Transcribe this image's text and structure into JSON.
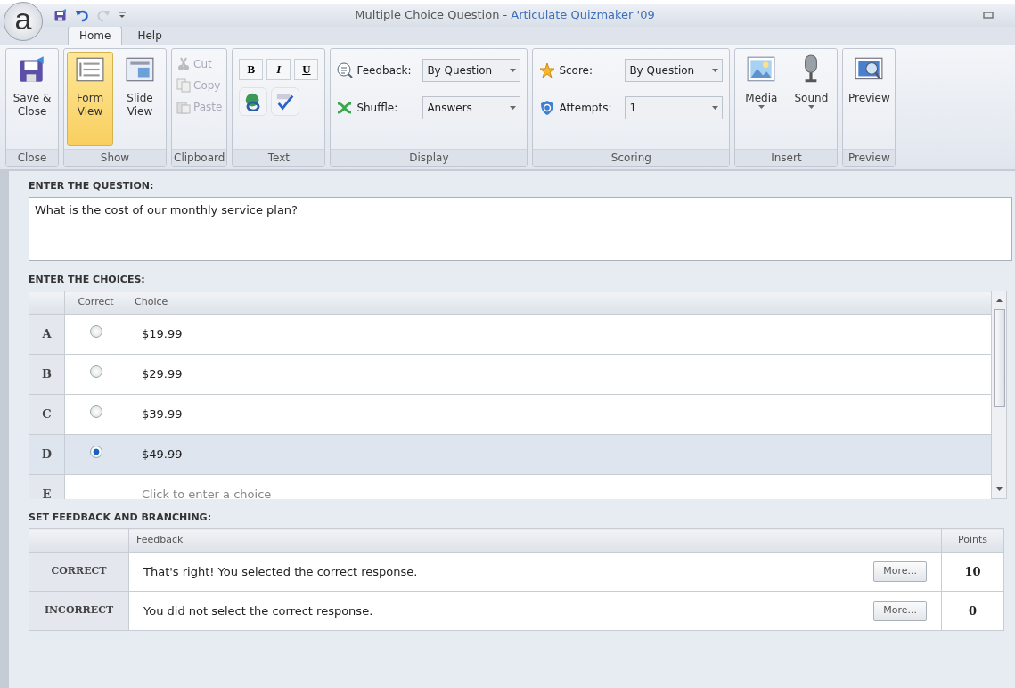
{
  "window": {
    "title": "Multiple Choice Question - ",
    "app_name": "Articulate Quizmaker '09"
  },
  "app_button": {
    "label": "a"
  },
  "quick_access": [
    {
      "disabled": false
    },
    {
      "disabled": false
    },
    {
      "disabled": true
    },
    {
      "disabled": false
    }
  ],
  "tabs": [
    {
      "label": "Home",
      "selected": true
    },
    {
      "label": "Help",
      "selected": false
    }
  ],
  "ribbon_groups": [
    {
      "label": "Close",
      "kind": "large",
      "items": [
        {
          "label": "Save & Close",
          "selected": false,
          "dropdown": false
        }
      ]
    },
    {
      "label": "Show",
      "kind": "large",
      "items": [
        {
          "label": "Form View",
          "selected": true,
          "dropdown": false
        },
        {
          "label": "Slide View",
          "selected": false,
          "dropdown": false
        }
      ]
    },
    {
      "label": "Clipboard",
      "kind": "small",
      "items": [
        {
          "label": "Cut",
          "disabled": true
        },
        {
          "label": "Copy",
          "disabled": true
        },
        {
          "label": "Paste",
          "disabled": true
        }
      ]
    },
    {
      "label": "Text",
      "kind": "text",
      "format": [
        "B",
        "I",
        "U"
      ]
    },
    {
      "label": "Display",
      "kind": "fields",
      "items": [
        {
          "label": "Feedback:",
          "value": "By Question"
        },
        {
          "label": "Shuffle:",
          "value": "Answers"
        }
      ]
    },
    {
      "label": "Scoring",
      "kind": "fields",
      "items": [
        {
          "label": "Score:",
          "value": "By Question"
        },
        {
          "label": "Attempts:",
          "value": "1"
        }
      ]
    },
    {
      "label": "Insert",
      "kind": "large",
      "items": [
        {
          "label": "Media",
          "selected": false,
          "dropdown": true
        },
        {
          "label": "Sound",
          "selected": false,
          "dropdown": true
        }
      ]
    },
    {
      "label": "Preview",
      "kind": "large",
      "items": [
        {
          "label": "Preview",
          "selected": false,
          "dropdown": false
        }
      ]
    }
  ],
  "question": {
    "heading": "ENTER THE QUESTION:",
    "value": "What is the cost of our monthly service plan?"
  },
  "choices": {
    "heading": "ENTER THE CHOICES:",
    "columns": [
      "Correct",
      "Choice"
    ],
    "rows": [
      {
        "letter": "A",
        "text": "$19.99",
        "correct": false,
        "selected": false
      },
      {
        "letter": "B",
        "text": "$29.99",
        "correct": false,
        "selected": false
      },
      {
        "letter": "C",
        "text": "$39.99",
        "correct": false,
        "selected": false
      },
      {
        "letter": "D",
        "text": "$49.99",
        "correct": true,
        "selected": true
      },
      {
        "letter": "E",
        "placeholder": "Click to enter a choice",
        "selected": false
      }
    ]
  },
  "feedback": {
    "heading": "SET FEEDBACK AND BRANCHING:",
    "columns": [
      "Feedback",
      "Points"
    ],
    "rows": [
      {
        "label": "CORRECT",
        "text": "That's right!  You selected the correct response.",
        "button": "More...",
        "points": "10"
      },
      {
        "label": "INCORRECT",
        "text": "You did not select the correct response.",
        "button": "More...",
        "points": "0"
      }
    ]
  }
}
